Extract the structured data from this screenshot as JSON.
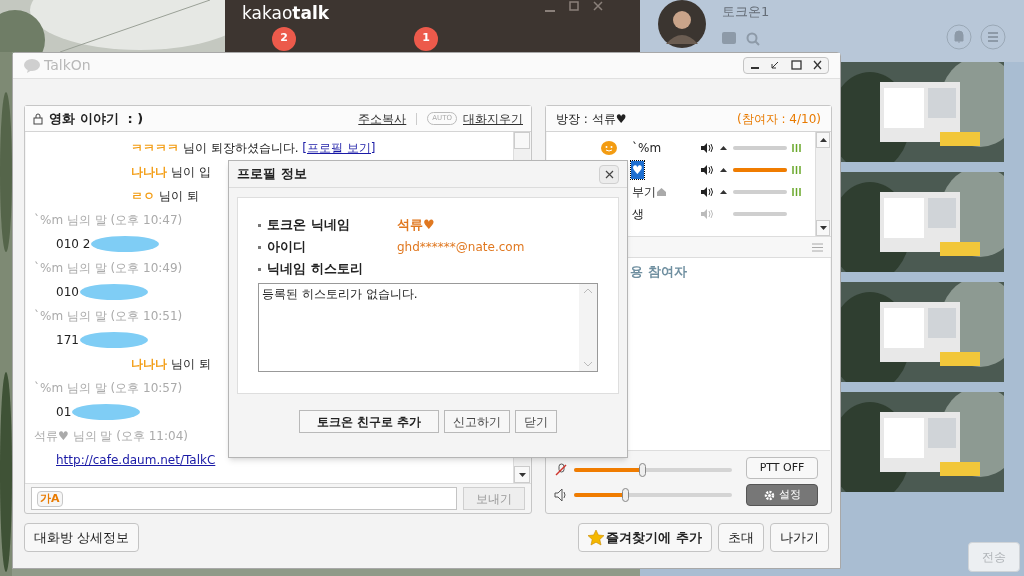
{
  "kakaotalk_window": {
    "logo": "kakao**talk**",
    "badges": [
      "2",
      "1"
    ]
  },
  "profile_window": {
    "title": "토크온1",
    "send_button": {
      "label": "전송",
      "disabled": true
    }
  },
  "talkon": {
    "title": "TalkOn",
    "room": {
      "title": "영화 이야기  : )",
      "copy_link": "주소복사",
      "auto_badge": "AUTO",
      "clear_link": "대화지우기"
    },
    "messages": [
      {
        "kind": "system",
        "name": "ㅋㅋㅋㅋ",
        "text": "님이 퇴장하셨습니다.",
        "link": "[프로필 보기]"
      },
      {
        "kind": "system",
        "name": "나나나",
        "text": "님이 입"
      },
      {
        "kind": "system",
        "name": "ㄹㅇ",
        "text": "님이 퇴"
      },
      {
        "kind": "header",
        "text": "`%m 님의 말 (오후 10:47)"
      },
      {
        "kind": "body",
        "text": "010 2",
        "redacted": true
      },
      {
        "kind": "header",
        "text": "`%m 님의 말 (오후 10:49)"
      },
      {
        "kind": "body",
        "text": "010",
        "redacted": true
      },
      {
        "kind": "header",
        "text": "`%m 님의 말 (오후 10:51)"
      },
      {
        "kind": "body",
        "text": "171",
        "redacted": true
      },
      {
        "kind": "system",
        "name": "나나나",
        "text": "님이 퇴"
      },
      {
        "kind": "header",
        "text": "`%m 님의 말 (오후 10:57)"
      },
      {
        "kind": "body",
        "text": "01",
        "redacted": true
      },
      {
        "kind": "header",
        "text": "석류♥ 님의 말 (오후 11:04)"
      },
      {
        "kind": "link",
        "text": "http://cafe.daum.net/TalkC"
      }
    ],
    "input": {
      "font_button": "가A",
      "send_button": "보내기"
    },
    "owner": {
      "label": "방장 : 석류♥",
      "count": "(참여자 : 4/10)"
    },
    "participants": [
      {
        "name": "`%m",
        "emoticon": true,
        "badge": false,
        "selected": false,
        "muted": false,
        "level": 0
      },
      {
        "name": "♥",
        "emoticon": false,
        "badge": false,
        "selected": true,
        "muted": false,
        "level": 1
      },
      {
        "name": "부기",
        "emoticon": false,
        "badge": true,
        "selected": false,
        "muted": false,
        "level": 0
      },
      {
        "name": "생",
        "emoticon": false,
        "badge": false,
        "selected": false,
        "muted": true,
        "level": 0
      }
    ],
    "lower_panel_text": "용 참여자",
    "mic": {
      "level": 0.43
    },
    "speaker": {
      "level": 0.32
    },
    "ptt_button": "PTT OFF",
    "settings_button": "설정",
    "bottom_buttons": [
      {
        "kind": "plain",
        "label": "대화방 상세정보"
      },
      {
        "kind": "favorite",
        "label": "즐겨찾기에 추가"
      },
      {
        "kind": "plain",
        "label": "초대"
      },
      {
        "kind": "plain",
        "label": "나가기"
      }
    ]
  },
  "dialog": {
    "title": "프로필 정보",
    "fields": [
      {
        "label": "토크온 닉네임",
        "value": "석류♥",
        "bold": true
      },
      {
        "label": "아이디",
        "value": "ghd******@nate.com",
        "bold": false
      },
      {
        "label": "닉네임 히스토리"
      }
    ],
    "history": "등록된 히스토리가 없습니다.",
    "buttons": [
      {
        "label": "토크온 친구로 추가",
        "primary": true
      },
      {
        "label": "신고하기",
        "primary": false
      },
      {
        "label": "닫기",
        "primary": false
      }
    ]
  }
}
